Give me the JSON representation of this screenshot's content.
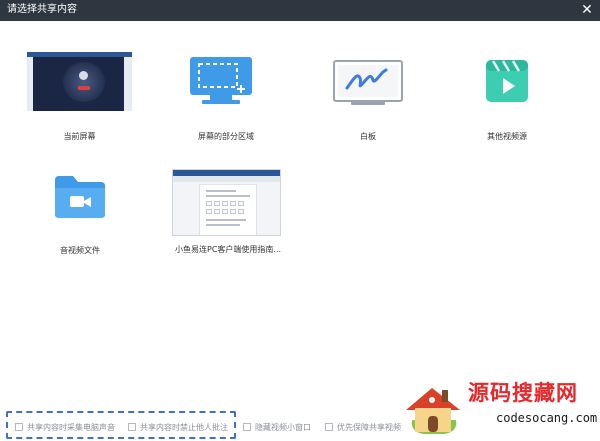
{
  "window": {
    "title": "请选择共享内容",
    "close_glyph": "✕"
  },
  "share_sources": [
    {
      "label": "当前屏幕",
      "icon": "current-screen-thumbnail"
    },
    {
      "label": "屏幕的部分区域",
      "icon": "partial-screen-region-icon"
    },
    {
      "label": "白板",
      "icon": "whiteboard-icon"
    },
    {
      "label": "其他视频源",
      "icon": "video-clapper-icon"
    },
    {
      "label": "音视频文件",
      "icon": "video-folder-icon"
    },
    {
      "label": "小鱼易连PC客户端使用指南...",
      "icon": "document-window-thumbnail"
    }
  ],
  "options": [
    {
      "label": "共享内容时采集电脑声音",
      "checked": false
    },
    {
      "label": "共享内容时禁止他人批注",
      "checked": false
    },
    {
      "label": "隐藏视频小窗口",
      "checked": false
    },
    {
      "label": "优先保障共享视频",
      "checked": false
    }
  ],
  "watermark": {
    "text": "源码搜藏网",
    "domain": "codesocang.com"
  },
  "colors": {
    "titlebar": "#2e3740",
    "accent_blue": "#3f9be8",
    "teal": "#3dcdb0",
    "dashed_highlight": "#3d6fd6",
    "watermark_red": "#e8272b"
  }
}
